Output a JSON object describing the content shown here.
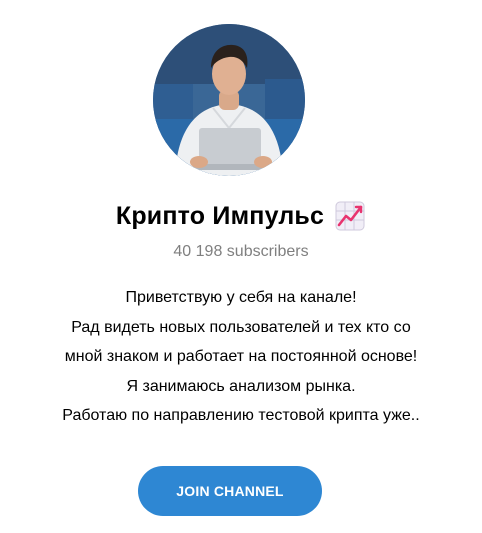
{
  "channel": {
    "title": "Крипто Импульс",
    "title_emoji_icon": "chart-increasing-icon",
    "subscribers": "40 198 subscribers",
    "description_lines": [
      "Приветствую у себя на канале!",
      "Рад видеть новых пользователей и тех кто со",
      "мной знаком и работает на постоянной основе!",
      "Я занимаюсь анализом рынка.",
      "Работаю по направлению тестовой крипта уже.."
    ]
  },
  "actions": {
    "join_label": "JOIN CHANNEL"
  },
  "colors": {
    "accent": "#2e87d3",
    "subtitle": "#7f7f7f",
    "avatar_background": "#2f5a8c"
  }
}
